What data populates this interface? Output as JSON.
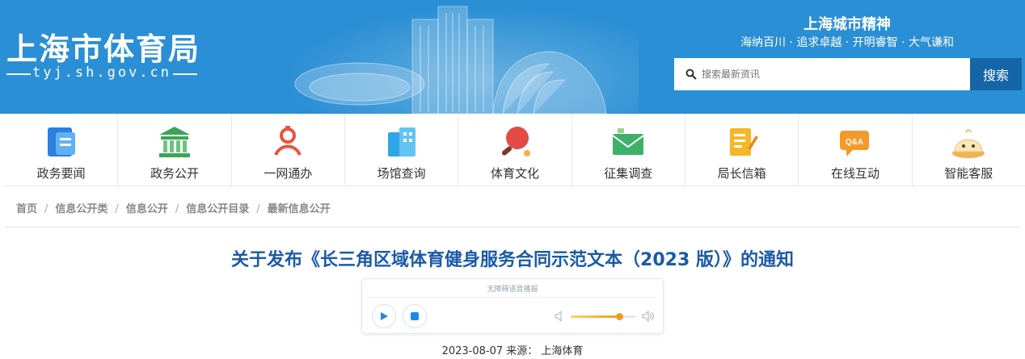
{
  "header": {
    "logo_name": "上海市体育局",
    "logo_url": "tyj.sh.gov.cn",
    "spirit_title": "上海城市精神",
    "spirit_subtitle": "海纳百川 · 追求卓越 · 开明睿智 · 大气谦和",
    "search_placeholder": "搜索最新资讯",
    "search_button": "搜索",
    "colors": {
      "banner": "#2a8fd4",
      "search_button": "#1566a6"
    }
  },
  "nav": [
    {
      "label": "政务要闻",
      "icon": "document-icon"
    },
    {
      "label": "政务公开",
      "icon": "government-building-icon"
    },
    {
      "label": "一网通办",
      "icon": "service-logo-icon"
    },
    {
      "label": "场馆查询",
      "icon": "building-icon"
    },
    {
      "label": "体育文化",
      "icon": "ping-pong-paddle-icon"
    },
    {
      "label": "征集调查",
      "icon": "mail-icon"
    },
    {
      "label": "局长信箱",
      "icon": "letter-clipboard-icon"
    },
    {
      "label": "在线互动",
      "icon": "qa-chat-icon"
    },
    {
      "label": "智能客服",
      "icon": "bun-robot-icon"
    }
  ],
  "breadcrumb": [
    "首页",
    "信息公开类",
    "信息公开",
    "信息公开目录",
    "最新信息公开"
  ],
  "article": {
    "title": "关于发布《长三角区域体育健身服务合同示范文本（2023 版）》的通知",
    "date": "2023-08-07",
    "source_label": "来源：",
    "source": "上海体育"
  },
  "player": {
    "caption": "无障碍语音播报",
    "volume": 0.75,
    "accent": "#1e88e5"
  }
}
